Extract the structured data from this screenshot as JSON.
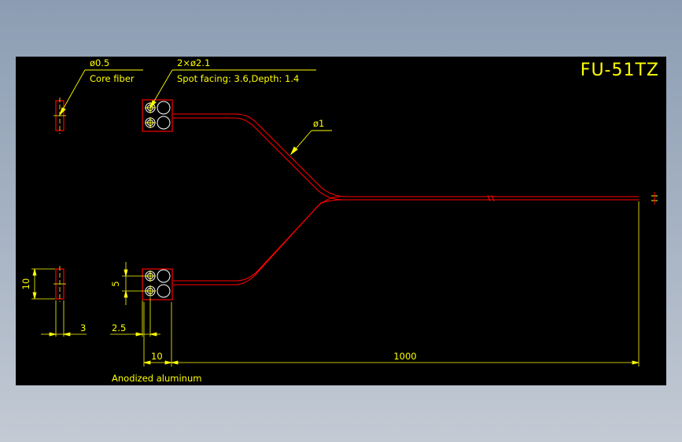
{
  "drawing": {
    "title": "FU-51TZ",
    "core_fiber_callout": {
      "line1": "ø0.5",
      "line2": "Core fiber"
    },
    "hole_callout": {
      "line1": "2×ø2.1",
      "line2": "Spot facing: 3.6,Depth: 1.4"
    },
    "fiber_dia_callout": "ø1",
    "dimensions": {
      "height_10": "10",
      "width_3": "3",
      "pitch_5": "5",
      "offset_2_5": "2.5",
      "head_10": "10",
      "length_1000": "1000"
    },
    "material": "Anodized aluminum"
  },
  "colors": {
    "background": "#000000",
    "fiber": "#ff0000",
    "dimension": "#ffff00",
    "hole": "#ffffff",
    "frame_gradient_top": "#8c9db3"
  }
}
